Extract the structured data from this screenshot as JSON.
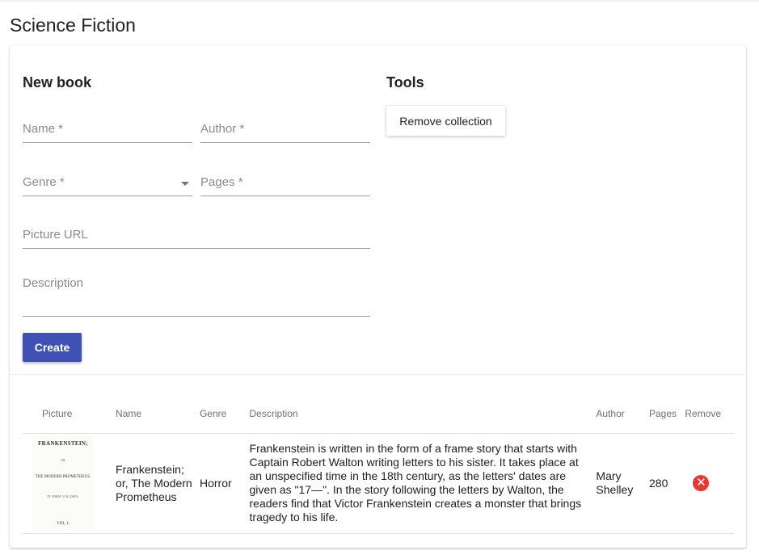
{
  "page": {
    "title": "Science Fiction"
  },
  "new_book": {
    "title": "New book",
    "fields": {
      "name_placeholder": "Name *",
      "author_placeholder": "Author *",
      "genre_label": "Genre *",
      "pages_placeholder": "Pages *",
      "picture_placeholder": "Picture URL",
      "description_placeholder": "Description"
    },
    "create_label": "Create"
  },
  "tools": {
    "title": "Tools",
    "remove_collection_label": "Remove collection"
  },
  "table": {
    "headers": {
      "picture": "Picture",
      "name": "Name",
      "genre": "Genre",
      "description": "Description",
      "author": "Author",
      "pages": "Pages",
      "remove": "Remove"
    },
    "rows": [
      {
        "cover": {
          "title": "FRANKENSTEIN;",
          "or": "OR,",
          "subtitle": "THE MODERN PROMETHEUS.",
          "volume": "IN THREE VOLUMES.",
          "vol": "VOL. I."
        },
        "name": "Frankenstein; or, The Modern Prometheus",
        "genre": "Horror",
        "description": "Frankenstein is written in the form of a frame story that starts with Captain Robert Walton writing letters to his sister. It takes place at an unspecified time in the 18th century, as the letters' dates are given as \"17—\". In the story following the letters by Walton, the readers find that Victor Frankenstein creates a monster that brings tragedy to his life.",
        "author": "Mary Shelley",
        "pages": "280",
        "remove_icon": "close-circle-icon"
      }
    ]
  },
  "colors": {
    "primary": "#3f51b5",
    "danger": "#e53935"
  }
}
